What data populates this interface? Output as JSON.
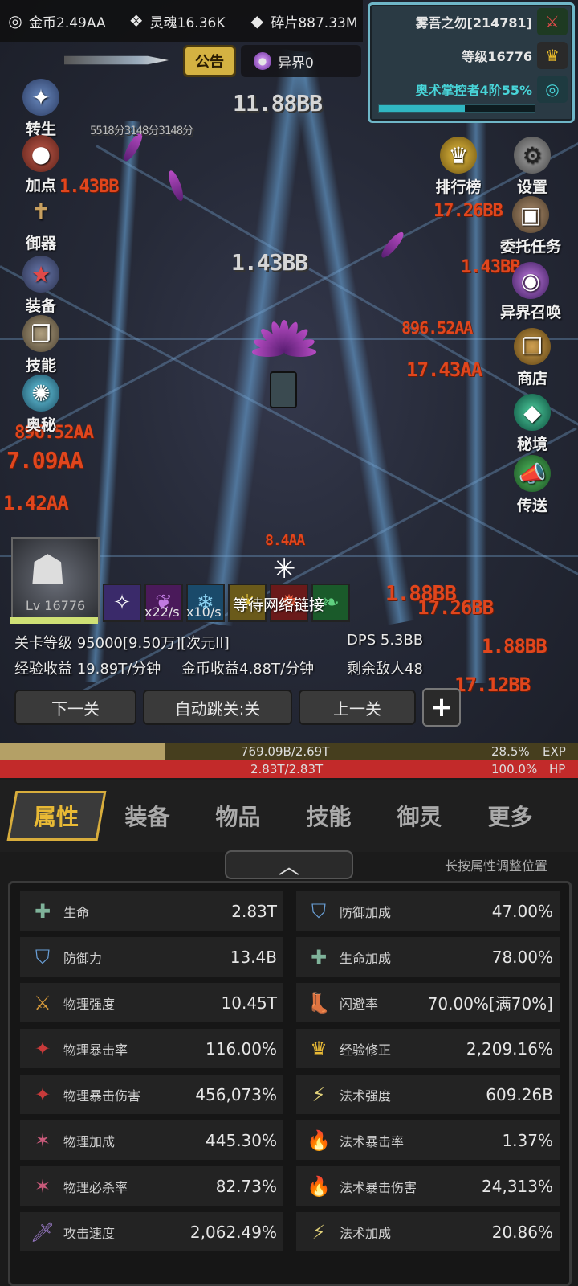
{
  "resources": [
    {
      "icon": "coin-icon",
      "label": "金币2.49AA"
    },
    {
      "icon": "soul-icon",
      "label": "灵魂16.36K"
    },
    {
      "icon": "shard-icon",
      "label": "碎片887.33M"
    }
  ],
  "player": {
    "name": "雾吾之勿[214781]",
    "level": "等级16776",
    "mastery": "奥术掌控者4阶55%",
    "mastery_progress": 0.55
  },
  "notice_label": "公告",
  "realm_label": "异界0",
  "left_menu": [
    "转生",
    "加点",
    "御器",
    "装备",
    "技能",
    "奥秘"
  ],
  "right_menu": [
    "排行榜",
    "设置",
    "委托任务",
    "异界召唤",
    "商店",
    "秘境",
    "传送"
  ],
  "damage_numbers": [
    "11.88BB",
    "1.43BB",
    "7.09AA",
    "1.42AA",
    "17.26BB",
    "896.52AA",
    "1.43BB",
    "17.26BB",
    "1.88BB",
    "17.43AA",
    "5518分3148分3148分",
    "896.52AA",
    "1.43BB",
    "8.4AA",
    "1.88BB",
    "17.12BB"
  ],
  "boss_level": "Lv 16776",
  "skill_rates": [
    "x22/s",
    "x10/s"
  ],
  "network_status": "等待网络链接",
  "stage": {
    "level": "关卡等级 95000[9.50万][次元II]",
    "dps": "DPS 5.3BB",
    "exp_gain": "经验收益 19.89T/分钟",
    "gold_gain": "金币收益4.88T/分钟",
    "enemies": "剩余敌人48"
  },
  "nav": {
    "next": "下一关",
    "auto": "自动跳关:关",
    "prev": "上一关",
    "plus": "+"
  },
  "exp": {
    "value": "769.09B/2.69T",
    "percent": "28.5%",
    "label": "EXP",
    "fraction": 0.285
  },
  "hp": {
    "value": "2.83T/2.83T",
    "percent": "100.0%",
    "label": "HP",
    "fraction": 1.0
  },
  "tabs": [
    "属性",
    "装备",
    "物品",
    "技能",
    "御灵",
    "更多"
  ],
  "hint": "长按属性调整位置",
  "attributes": [
    {
      "name": "生命",
      "value": "2.83T",
      "icon": "plus-icon",
      "color": "#7fb39a"
    },
    {
      "name": "防御加成",
      "value": "47.00%",
      "icon": "shield-icon",
      "color": "#6aa0d8"
    },
    {
      "name": "防御力",
      "value": "13.4B",
      "icon": "shield-icon",
      "color": "#6aa0d8"
    },
    {
      "name": "生命加成",
      "value": "78.00%",
      "icon": "plus-icon",
      "color": "#7fb39a"
    },
    {
      "name": "物理强度",
      "value": "10.45T",
      "icon": "blade-icon",
      "color": "#d99b3a"
    },
    {
      "name": "闪避率",
      "value": "70.00%[满70%]",
      "icon": "boot-icon",
      "color": "#e3c44e"
    },
    {
      "name": "物理暴击率",
      "value": "116.00%",
      "icon": "crit-icon",
      "color": "#c83a3a"
    },
    {
      "name": "经验修正",
      "value": "2,209.16%",
      "icon": "crown-icon",
      "color": "#e8b935"
    },
    {
      "name": "物理暴击伤害",
      "value": "456,073%",
      "icon": "crit-icon",
      "color": "#c83a3a"
    },
    {
      "name": "法术强度",
      "value": "609.26B",
      "icon": "lightning-icon",
      "color": "#e2d27a"
    },
    {
      "name": "物理加成",
      "value": "445.30%",
      "icon": "burst-icon",
      "color": "#c85a7a"
    },
    {
      "name": "法术暴击率",
      "value": "1.37%",
      "icon": "flame-icon",
      "color": "#5a9ae0"
    },
    {
      "name": "物理必杀率",
      "value": "82.73%",
      "icon": "burst-icon",
      "color": "#c85a7a"
    },
    {
      "name": "法术暴击伤害",
      "value": "24,313%",
      "icon": "flame-icon",
      "color": "#5a9ae0"
    },
    {
      "name": "攻击速度",
      "value": "2,062.49%",
      "icon": "sword-icon",
      "color": "#9a7ac8"
    },
    {
      "name": "法术加成",
      "value": "20.86%",
      "icon": "lightning-icon",
      "color": "#e2d27a"
    }
  ]
}
